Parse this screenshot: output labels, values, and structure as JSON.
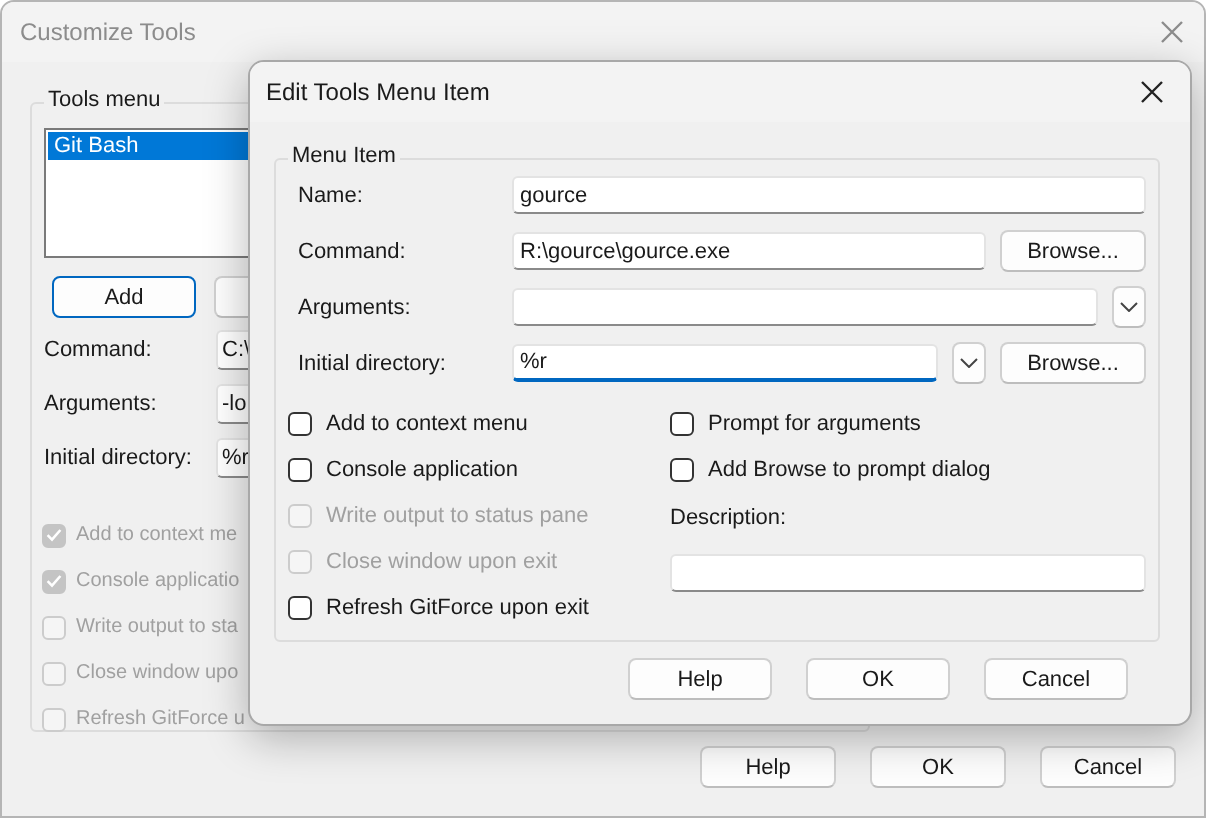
{
  "background_window": {
    "title": "Customize Tools",
    "group": "Tools menu",
    "list_items": [
      {
        "label": "Git Bash",
        "selected": true
      }
    ],
    "list_buttons": [
      "Add"
    ],
    "fields": [
      {
        "label": "Command:",
        "value": "C:\\"
      },
      {
        "label": "Arguments:",
        "value": "-lo"
      },
      {
        "label": "Initial directory:",
        "value": "%r"
      }
    ],
    "checkboxes": [
      {
        "label": "Add to context me",
        "checked": true,
        "disabled": true
      },
      {
        "label": "Console applicatio",
        "checked": true,
        "disabled": true
      },
      {
        "label": "Write output to sta",
        "checked": false,
        "disabled": true
      },
      {
        "label": "Close window upo",
        "checked": false,
        "disabled": true
      },
      {
        "label": "Refresh GitForce u",
        "checked": false,
        "disabled": true
      }
    ],
    "buttons": [
      "Help",
      "OK",
      "Cancel"
    ]
  },
  "dialog": {
    "title": "Edit Tools Menu Item",
    "group": "Menu Item",
    "fields": [
      {
        "kind": "text",
        "label": "Name:",
        "value": "gource",
        "focused": false
      },
      {
        "kind": "browse",
        "label": "Command:",
        "value": "R:\\gource\\gource.exe",
        "button": "Browse...",
        "focused": false
      },
      {
        "kind": "combo",
        "label": "Arguments:",
        "focused": false
      },
      {
        "kind": "combo-browse",
        "label": "Initial directory:",
        "value": "%r",
        "button": "Browse...",
        "focused": true
      }
    ],
    "left_checkboxes": [
      {
        "label": "Add to context menu",
        "checked": false,
        "disabled": false
      },
      {
        "label": "Console application",
        "checked": false,
        "disabled": false
      },
      {
        "label": "Write output to status pane",
        "checked": false,
        "disabled": true
      },
      {
        "label": "Close window upon exit",
        "checked": false,
        "disabled": true
      },
      {
        "label": "Refresh GitForce upon exit",
        "checked": false,
        "disabled": false
      }
    ],
    "right_checkboxes": [
      {
        "label": "Prompt for arguments",
        "checked": false,
        "disabled": false
      },
      {
        "label": "Add Browse to prompt dialog",
        "checked": false,
        "disabled": false
      }
    ],
    "description": {
      "label": "Description:"
    },
    "buttons": [
      "Help",
      "OK",
      "Cancel"
    ]
  }
}
